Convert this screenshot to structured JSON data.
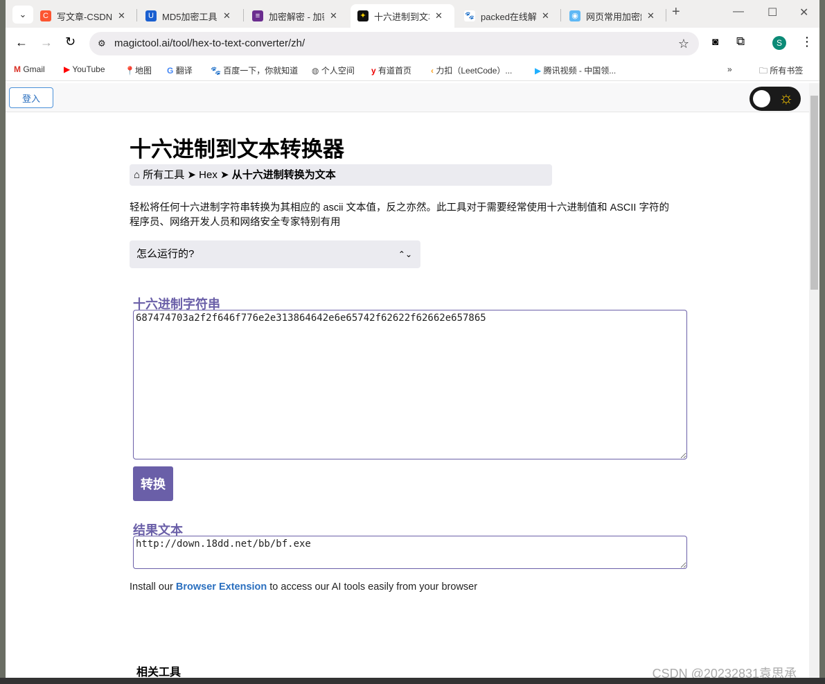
{
  "browser": {
    "tabs": [
      {
        "title": "写文章-CSDN博客",
        "icon_color": "#fc5531",
        "icon": "C"
      },
      {
        "title": "MD5加密工具",
        "icon_color": "#1a5fd0",
        "icon": "U"
      },
      {
        "title": "加密解密 - 加密",
        "icon_color": "#6b2d8f",
        "icon": "≡"
      },
      {
        "title": "十六进制到文本",
        "icon_color": "#111",
        "icon": "✦",
        "active": true
      },
      {
        "title": "packed在线解密",
        "icon_color": "#2932e1",
        "icon": "🐾"
      },
      {
        "title": "网页常用加密解",
        "icon_color": "#5fb8f5",
        "icon": "◉"
      }
    ],
    "url": "magictool.ai/tool/hex-to-text-converter/zh/",
    "profile_initial": "S",
    "bookmarks": [
      "Gmail",
      "YouTube",
      "地图",
      "翻译",
      "百度一下，你就知道",
      "个人空间",
      "有道首页",
      "力扣（LeetCode）...",
      "腾讯视频 - 中国领..."
    ],
    "all_bookmarks": "所有书签"
  },
  "page": {
    "login": "登入",
    "title": "十六进制到文本转换器",
    "breadcrumb": {
      "home": "所有工具",
      "sep": "➤",
      "mid": "Hex",
      "current": "从十六进制转换为文本"
    },
    "description": "轻松将任何十六进制字符串转换为其相应的 ascii 文本值，反之亦然。此工具对于需要经常使用十六进制值和 ASCII 字符的程序员、网络开发人员和网络安全专家特别有用",
    "accordion": "怎么运行的?",
    "input_label": "十六进制字符串",
    "input_value": "687474703a2f2f646f776e2e313864642e6e65742f62622f62662e657865",
    "convert": "转换",
    "result_label": "结果文本",
    "result_value": "http://down.18dd.net/bb/bf.exe",
    "ext_pre": "Install our ",
    "ext_link": "Browser Extension",
    "ext_post": " to access our AI tools easily from your browser",
    "related": "相关工具"
  },
  "watermark": "CSDN @20232831袁思承",
  "colors": {
    "accent": "#6a5fa8",
    "link": "#2a6fbf"
  }
}
